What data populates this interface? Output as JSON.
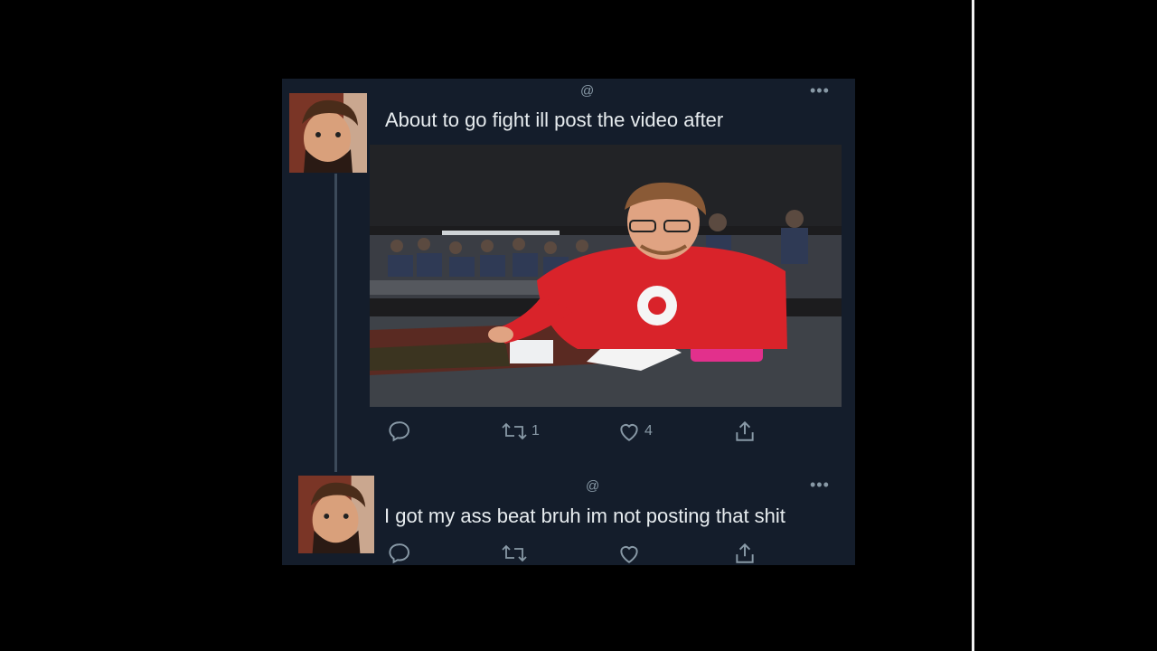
{
  "tweets": [
    {
      "handle": "@",
      "text": "About to go fight ill post the video after",
      "retweets": "1",
      "likes": "4"
    },
    {
      "handle": "@",
      "text": "I got my ass beat bruh im not posting that shit"
    }
  ],
  "icons": {
    "more": "more-options-icon",
    "reply": "reply-icon",
    "retweet": "retweet-icon",
    "like": "heart-icon",
    "share": "share-icon"
  },
  "colors": {
    "background": "#000000",
    "card": "#141d2b",
    "text": "#e7ecef",
    "muted": "#8899a6",
    "hoodie_red": "#d9232a",
    "deck_box_pink": "#e2308c"
  }
}
